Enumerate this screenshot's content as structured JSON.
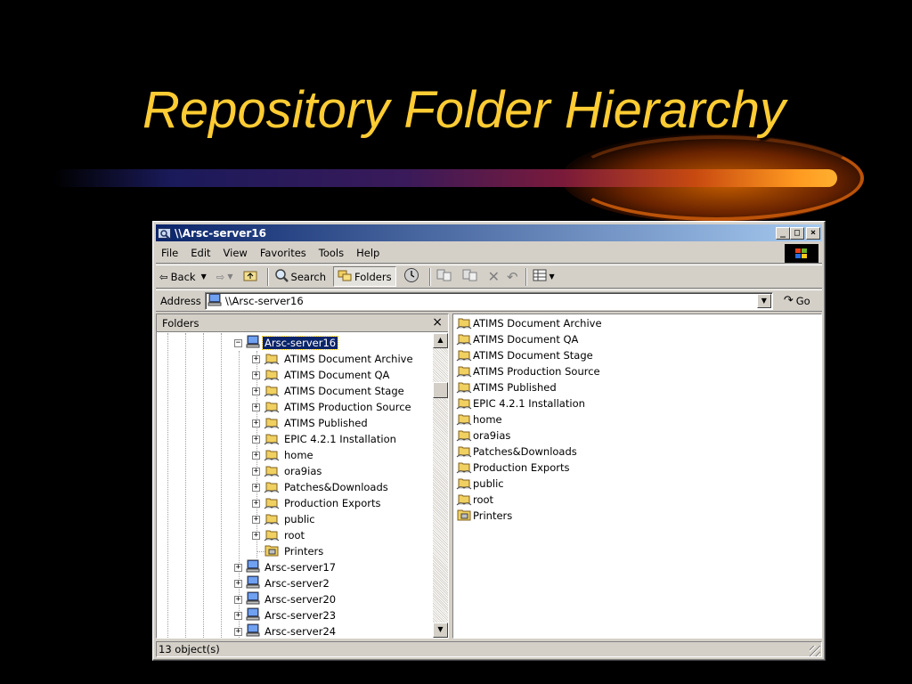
{
  "slide": {
    "title": "Repository Folder Hierarchy"
  },
  "window": {
    "title": "\\\\Arsc-server16",
    "caption_buttons": {
      "minimize": "_",
      "maximize": "□",
      "close": "×"
    },
    "menu": [
      "File",
      "Edit",
      "View",
      "Favorites",
      "Tools",
      "Help"
    ],
    "toolbar": {
      "back_label": "Back",
      "search_label": "Search",
      "folders_label": "Folders"
    },
    "address": {
      "label": "Address",
      "value": "\\\\Arsc-server16",
      "go_label": "Go"
    },
    "folders_pane": {
      "header": "Folders",
      "close": "×",
      "selected_node": "Arsc-server16",
      "children": [
        {
          "label": "ATIMS Document Archive",
          "type": "shared-folder",
          "expandable": true
        },
        {
          "label": "ATIMS Document QA",
          "type": "shared-folder",
          "expandable": true
        },
        {
          "label": "ATIMS Document Stage",
          "type": "shared-folder",
          "expandable": true
        },
        {
          "label": "ATIMS Production Source",
          "type": "shared-folder",
          "expandable": true
        },
        {
          "label": "ATIMS Published",
          "type": "shared-folder",
          "expandable": true
        },
        {
          "label": "EPIC 4.2.1 Installation",
          "type": "shared-folder",
          "expandable": true
        },
        {
          "label": "home",
          "type": "shared-folder",
          "expandable": true
        },
        {
          "label": "ora9ias",
          "type": "shared-folder",
          "expandable": true
        },
        {
          "label": "Patches&Downloads",
          "type": "shared-folder",
          "expandable": true
        },
        {
          "label": "Production Exports",
          "type": "shared-folder",
          "expandable": true
        },
        {
          "label": "public",
          "type": "shared-folder",
          "expandable": true
        },
        {
          "label": "root",
          "type": "shared-folder",
          "expandable": true
        },
        {
          "label": "Printers",
          "type": "printers-folder",
          "expandable": false
        }
      ],
      "siblings": [
        {
          "label": "Arsc-server17"
        },
        {
          "label": "Arsc-server2"
        },
        {
          "label": "Arsc-server20"
        },
        {
          "label": "Arsc-server23"
        },
        {
          "label": "Arsc-server24"
        }
      ]
    },
    "content_pane": {
      "items": [
        {
          "label": "ATIMS Document Archive",
          "type": "shared-folder"
        },
        {
          "label": "ATIMS Document QA",
          "type": "shared-folder"
        },
        {
          "label": "ATIMS Document Stage",
          "type": "shared-folder"
        },
        {
          "label": "ATIMS Production Source",
          "type": "shared-folder"
        },
        {
          "label": "ATIMS Published",
          "type": "shared-folder"
        },
        {
          "label": "EPIC 4.2.1 Installation",
          "type": "shared-folder"
        },
        {
          "label": "home",
          "type": "shared-folder"
        },
        {
          "label": "ora9ias",
          "type": "shared-folder"
        },
        {
          "label": "Patches&Downloads",
          "type": "shared-folder"
        },
        {
          "label": "Production Exports",
          "type": "shared-folder"
        },
        {
          "label": "public",
          "type": "shared-folder"
        },
        {
          "label": "root",
          "type": "shared-folder"
        },
        {
          "label": "Printers",
          "type": "printers-folder"
        }
      ]
    },
    "status": {
      "objects": "13 object(s)"
    }
  },
  "colors": {
    "title_text": "#ffcc33",
    "titlebar_start": "#0a246a",
    "titlebar_end": "#a6caf0",
    "selection": "#0a246a",
    "folder_yellow": "#f0d060"
  }
}
